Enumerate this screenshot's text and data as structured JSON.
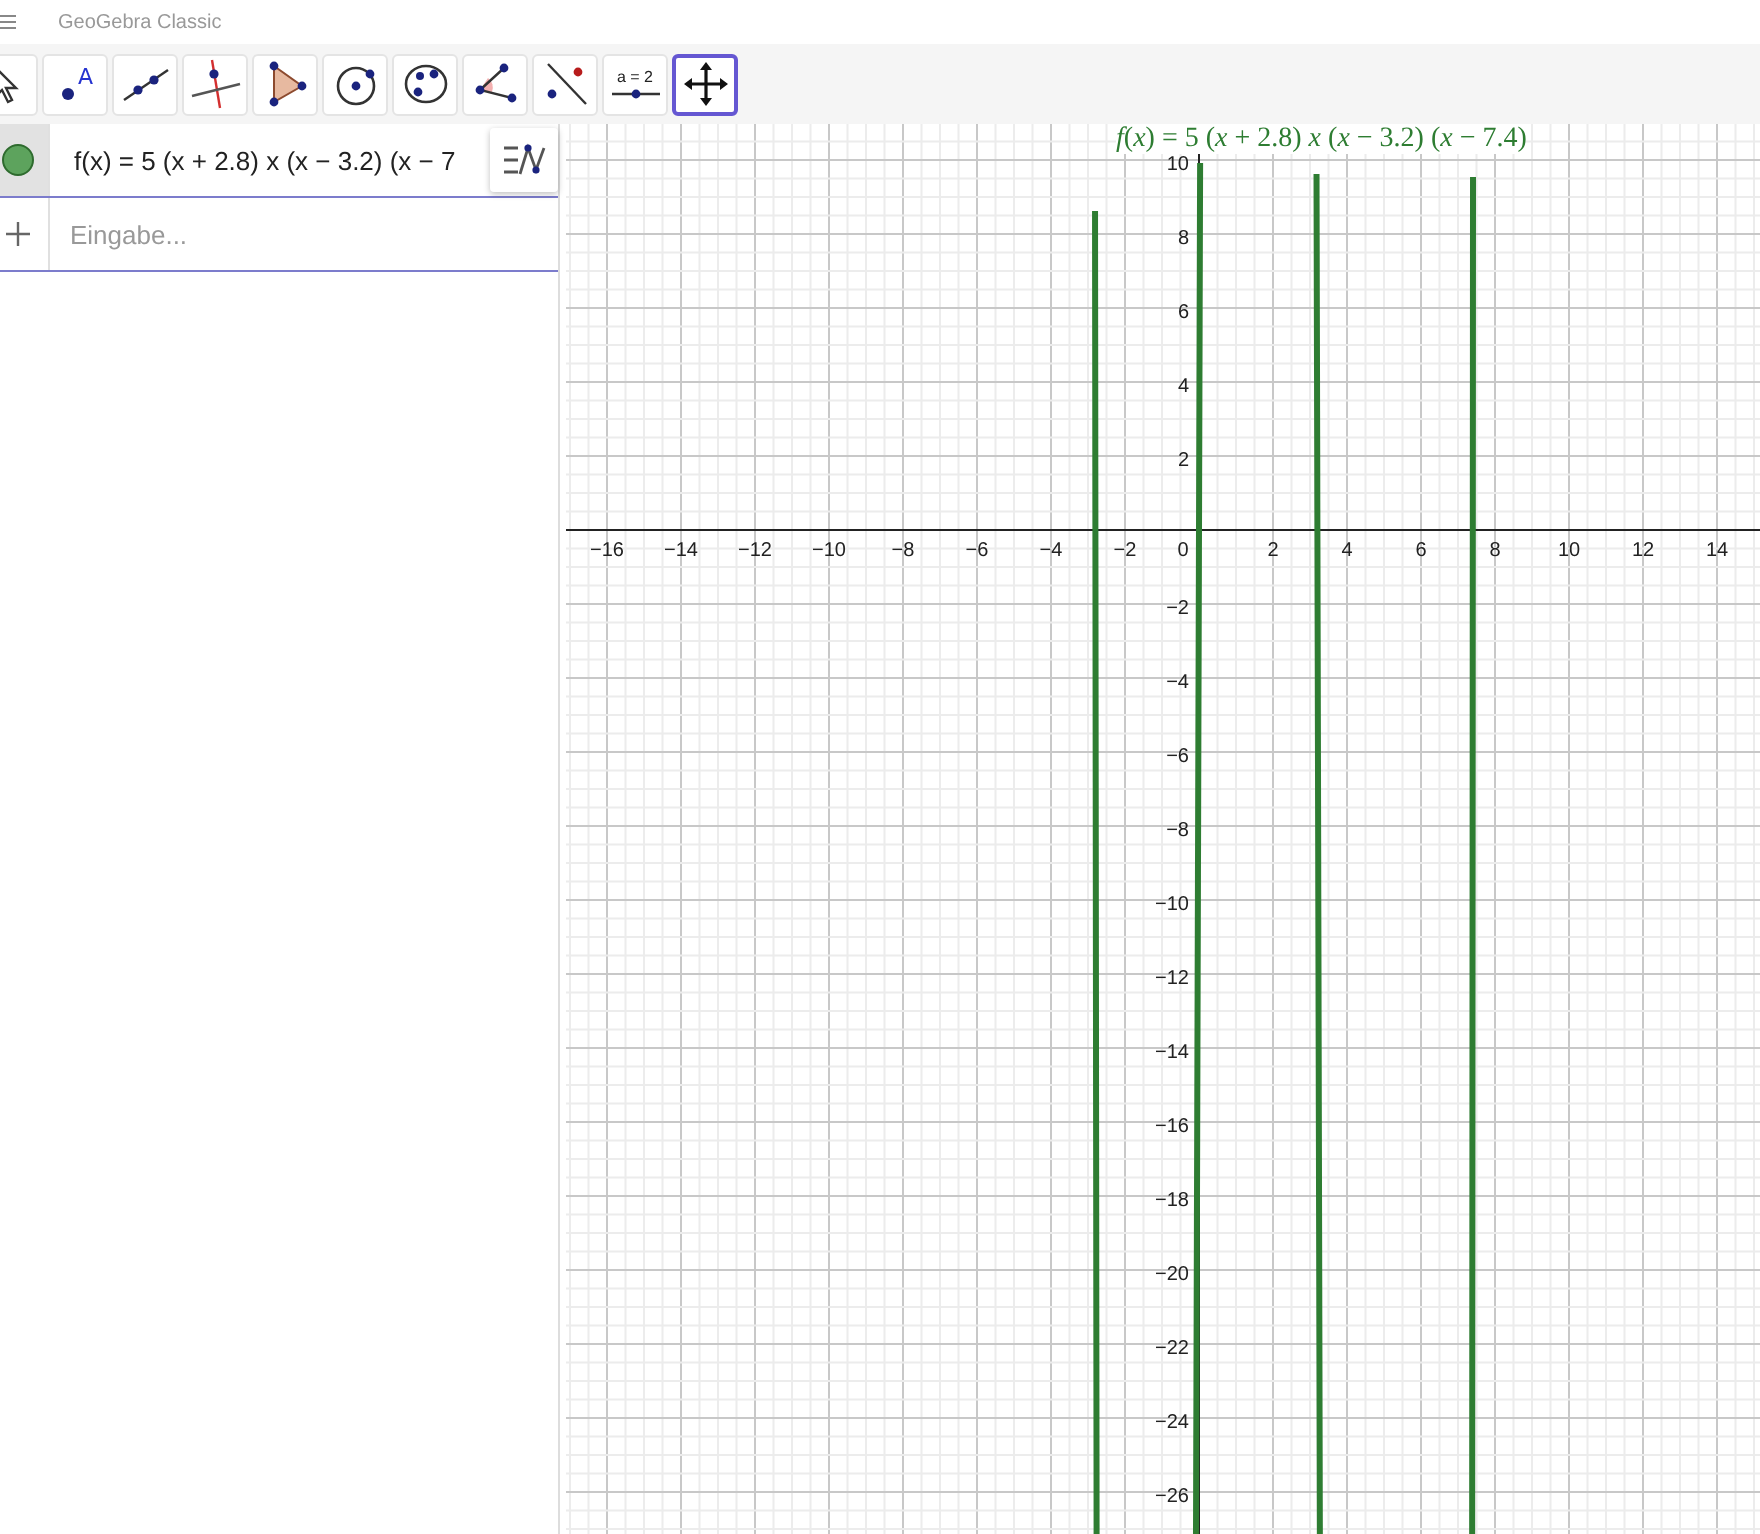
{
  "window": {
    "title": "GeoGebra Classic"
  },
  "toolbar": {
    "tools": [
      {
        "kind": "move",
        "selected": false
      },
      {
        "kind": "point",
        "selected": false,
        "label": "A"
      },
      {
        "kind": "line",
        "selected": false
      },
      {
        "kind": "perpendicular",
        "selected": false
      },
      {
        "kind": "polygon",
        "selected": false
      },
      {
        "kind": "circle",
        "selected": false
      },
      {
        "kind": "ellipse",
        "selected": false
      },
      {
        "kind": "angle",
        "selected": false
      },
      {
        "kind": "reflect",
        "selected": false
      },
      {
        "kind": "slider",
        "selected": false,
        "label": "a = 2"
      },
      {
        "kind": "move-view",
        "selected": true
      }
    ]
  },
  "algebra": {
    "items": [
      {
        "text": "f(x) = 5 (x + 2.8) x (x − 3.2) (x − 7",
        "visible": true
      }
    ],
    "input": {
      "placeholder": "Eingabe..."
    }
  },
  "graphics": {
    "label": "*f*(*x*) = 5 (*x* + 2.8) *x* (*x* − 3.2) (*x* − 7.4)",
    "x_ticks": [
      "−16",
      "−14",
      "−12",
      "−10",
      "−8",
      "−6",
      "−4",
      "−2",
      "0",
      "2",
      "4",
      "6",
      "8",
      "10",
      "12",
      "14"
    ],
    "y_ticks": [
      "10",
      "8",
      "6",
      "4",
      "2",
      "−2",
      "−4",
      "−6",
      "−8",
      "−10",
      "−12",
      "−14",
      "−16",
      "−18",
      "−20",
      "−22",
      "−24",
      "−26"
    ]
  }
}
